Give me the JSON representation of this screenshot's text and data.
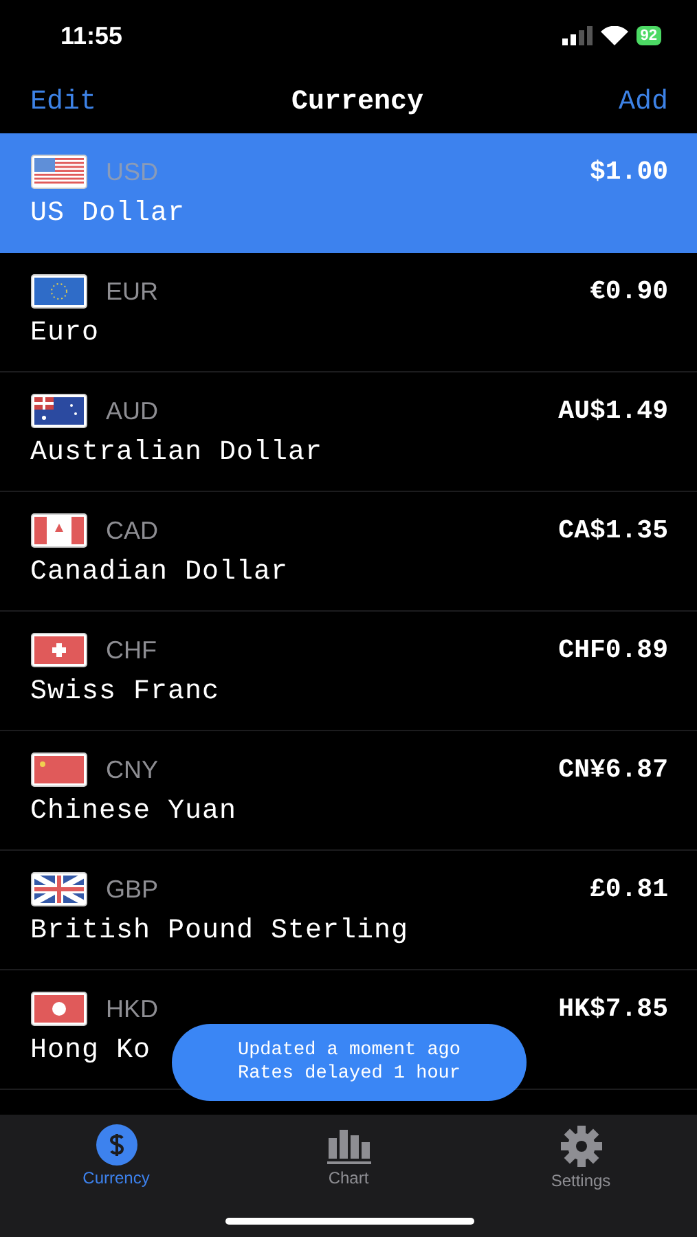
{
  "status_bar": {
    "time": "11:55",
    "battery": "92"
  },
  "nav": {
    "left": "Edit",
    "title": "Currency",
    "right": "Add"
  },
  "currencies": [
    {
      "code": "USD",
      "name": "US Dollar",
      "amount": "$1.00",
      "selected": true
    },
    {
      "code": "EUR",
      "name": "Euro",
      "amount": "€0.90",
      "selected": false
    },
    {
      "code": "AUD",
      "name": "Australian Dollar",
      "amount": "AU$1.49",
      "selected": false
    },
    {
      "code": "CAD",
      "name": "Canadian Dollar",
      "amount": "CA$1.35",
      "selected": false
    },
    {
      "code": "CHF",
      "name": "Swiss Franc",
      "amount": "CHF0.89",
      "selected": false
    },
    {
      "code": "CNY",
      "name": "Chinese Yuan",
      "amount": "CN¥6.87",
      "selected": false
    },
    {
      "code": "GBP",
      "name": "British Pound Sterling",
      "amount": "£0.81",
      "selected": false
    },
    {
      "code": "HKD",
      "name": "Hong Ko",
      "amount": "HK$7.85",
      "selected": false
    }
  ],
  "toast": {
    "lines": [
      "Updated a moment ago",
      "Rates delayed 1 hour"
    ]
  },
  "tabs": [
    {
      "label": "Currency",
      "selected": true
    },
    {
      "label": "Chart",
      "selected": false
    },
    {
      "label": "Settings",
      "selected": false
    }
  ]
}
